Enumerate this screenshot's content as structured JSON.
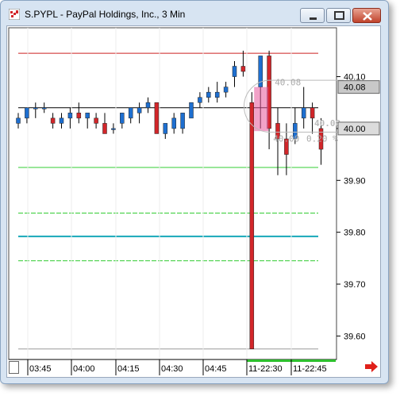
{
  "window": {
    "title": "S.PYPL - PayPal Holdings, Inc., 3 Min",
    "icons": {
      "app": "chart-app-icon",
      "minimize": "minimize-icon",
      "maximize": "maximize-icon",
      "close": "close-icon"
    }
  },
  "colors": {
    "up": "#1e6fd0",
    "down": "#d2262a",
    "resistance": "#cc2222",
    "support": "#33cc33",
    "teal": "#16a8b8",
    "pivot": "#000000"
  },
  "chart_data": {
    "type": "candlestick",
    "x_tick_labels": [
      "03:45",
      "04:00",
      "04:15",
      "04:30",
      "04:45",
      "11-22:30",
      "11-22:45"
    ],
    "y_tick_labels": [
      "40.10",
      "40.00",
      "39.90",
      "39.80",
      "39.70",
      "39.60"
    ],
    "y_ticks": [
      40.1,
      40.0,
      39.9,
      39.8,
      39.7,
      39.6
    ],
    "ylim": [
      39.57,
      40.185
    ],
    "price_tags": [
      "40.08",
      "40.00"
    ],
    "price_tag_values": [
      40.08,
      40.0
    ],
    "overlay_labels": [
      "40.08",
      "40.00",
      "0.20 %"
    ],
    "overlay_pct": "0.20 %",
    "faded_label": "40.08",
    "horizontal_lines": [
      {
        "value": 40.145,
        "style": "solid",
        "color": "resistance"
      },
      {
        "value": 40.04,
        "style": "solid",
        "color": "pivot"
      },
      {
        "value": 39.925,
        "style": "solid",
        "color": "support"
      },
      {
        "value": 39.837,
        "style": "dashed",
        "color": "support"
      },
      {
        "value": 39.792,
        "style": "solid",
        "color": "teal"
      },
      {
        "value": 39.745,
        "style": "dashed",
        "color": "support"
      },
      {
        "value": 39.575,
        "style": "solid",
        "color": "#999999"
      }
    ],
    "candles": [
      {
        "o": 40.01,
        "h": 40.03,
        "l": 40.0,
        "c": 40.02
      },
      {
        "o": 40.02,
        "h": 40.04,
        "l": 40.01,
        "c": 40.04
      },
      {
        "o": 40.04,
        "h": 40.05,
        "l": 40.02,
        "c": 40.04
      },
      {
        "o": 40.04,
        "h": 40.05,
        "l": 40.03,
        "c": 40.04
      },
      {
        "o": 40.02,
        "h": 40.03,
        "l": 40.0,
        "c": 40.01
      },
      {
        "o": 40.01,
        "h": 40.03,
        "l": 40.0,
        "c": 40.02
      },
      {
        "o": 40.02,
        "h": 40.04,
        "l": 40.0,
        "c": 40.03
      },
      {
        "o": 40.03,
        "h": 40.05,
        "l": 40.01,
        "c": 40.02
      },
      {
        "o": 40.02,
        "h": 40.03,
        "l": 40.0,
        "c": 40.03
      },
      {
        "o": 40.02,
        "h": 40.03,
        "l": 40.0,
        "c": 40.01
      },
      {
        "o": 40.01,
        "h": 40.03,
        "l": 39.99,
        "c": 39.99
      },
      {
        "o": 40.0,
        "h": 40.01,
        "l": 39.99,
        "c": 40.0
      },
      {
        "o": 40.01,
        "h": 40.03,
        "l": 40.0,
        "c": 40.03
      },
      {
        "o": 40.02,
        "h": 40.04,
        "l": 40.01,
        "c": 40.04
      },
      {
        "o": 40.03,
        "h": 40.05,
        "l": 40.01,
        "c": 40.04
      },
      {
        "o": 40.04,
        "h": 40.06,
        "l": 40.03,
        "c": 40.05
      },
      {
        "o": 40.05,
        "h": 40.05,
        "l": 39.99,
        "c": 39.99
      },
      {
        "o": 39.99,
        "h": 40.01,
        "l": 39.98,
        "c": 40.01
      },
      {
        "o": 40.0,
        "h": 40.03,
        "l": 39.99,
        "c": 40.02
      },
      {
        "o": 40.0,
        "h": 40.03,
        "l": 39.99,
        "c": 40.03
      },
      {
        "o": 40.02,
        "h": 40.05,
        "l": 40.02,
        "c": 40.05
      },
      {
        "o": 40.05,
        "h": 40.07,
        "l": 40.04,
        "c": 40.06
      },
      {
        "o": 40.06,
        "h": 40.08,
        "l": 40.05,
        "c": 40.07
      },
      {
        "o": 40.06,
        "h": 40.09,
        "l": 40.05,
        "c": 40.07
      },
      {
        "o": 40.07,
        "h": 40.09,
        "l": 40.06,
        "c": 40.08
      },
      {
        "o": 40.1,
        "h": 40.13,
        "l": 40.08,
        "c": 40.12
      },
      {
        "o": 40.12,
        "h": 40.15,
        "l": 40.1,
        "c": 40.11
      },
      {
        "o": 40.05,
        "h": 40.07,
        "l": 39.575,
        "c": 39.575
      },
      {
        "o": 40.08,
        "h": 40.14,
        "l": 40.0,
        "c": 40.14
      },
      {
        "o": 40.14,
        "h": 40.15,
        "l": 39.96,
        "c": 40.0
      },
      {
        "o": 40.01,
        "h": 40.04,
        "l": 39.91,
        "c": 39.98
      },
      {
        "o": 39.98,
        "h": 40.01,
        "l": 39.91,
        "c": 39.95
      },
      {
        "o": 39.98,
        "h": 40.04,
        "l": 39.97,
        "c": 40.01
      },
      {
        "o": 40.02,
        "h": 40.08,
        "l": 40.0,
        "c": 40.04
      },
      {
        "o": 40.04,
        "h": 40.05,
        "l": 39.99,
        "c": 40.02
      },
      {
        "o": 40.0,
        "h": 40.02,
        "l": 39.93,
        "c": 39.96
      }
    ]
  }
}
